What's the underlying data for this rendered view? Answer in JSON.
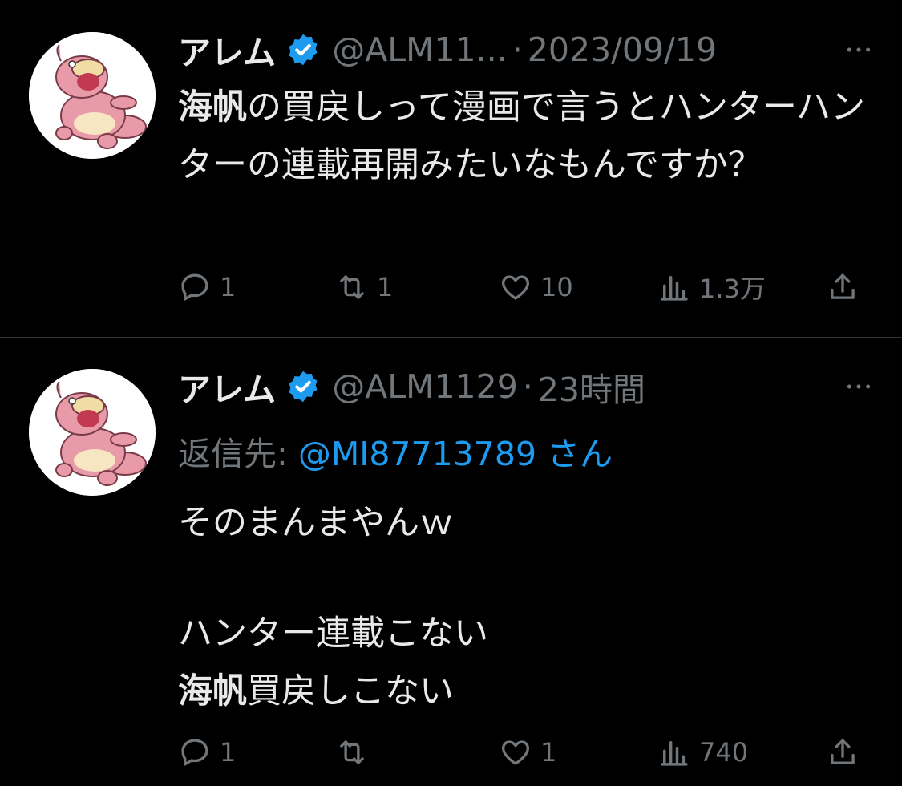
{
  "tweets": [
    {
      "author": {
        "name": "アレム",
        "handle": "@ALM11...",
        "verified": true
      },
      "dot": "·",
      "time": "2023/09/19",
      "more_icon": "more-dots-icon",
      "text_parts": [
        {
          "text": "海帆",
          "bold": true
        },
        {
          "text": "の買戻しって漫画で言うとハンターハンターの連載再開みたいなもんですか？",
          "bold": false
        }
      ],
      "stats": {
        "replies": "1",
        "retweets": "1",
        "likes": "10",
        "views": "1.3万"
      }
    },
    {
      "author": {
        "name": "アレム",
        "handle": "@ALM1129",
        "verified": true
      },
      "dot": "·",
      "time": "23時間",
      "more_icon": "more-dots-icon",
      "reply_to": {
        "prefix": "返信先:",
        "mention": "@MI87713789",
        "suffix": "さん"
      },
      "lines": [
        [
          {
            "text": "そのまんまやんｗ",
            "bold": false
          }
        ],
        [],
        [
          {
            "text": "ハンター連載こない",
            "bold": false
          }
        ],
        [
          {
            "text": "海帆",
            "bold": true
          },
          {
            "text": "買戻しこない",
            "bold": false
          }
        ]
      ],
      "stats": {
        "replies": "1",
        "retweets": "",
        "likes": "1",
        "views": "740"
      }
    }
  ],
  "colors": {
    "background": "#000000",
    "text": "#e7e9ea",
    "muted": "#71767b",
    "accent": "#1d9bf0",
    "divider": "#2f3336",
    "avatar_pink": "#e89aa8"
  },
  "icons": [
    "reply-icon",
    "retweet-icon",
    "like-icon",
    "views-icon",
    "share-icon",
    "verified-badge-icon",
    "more-dots-icon"
  ]
}
